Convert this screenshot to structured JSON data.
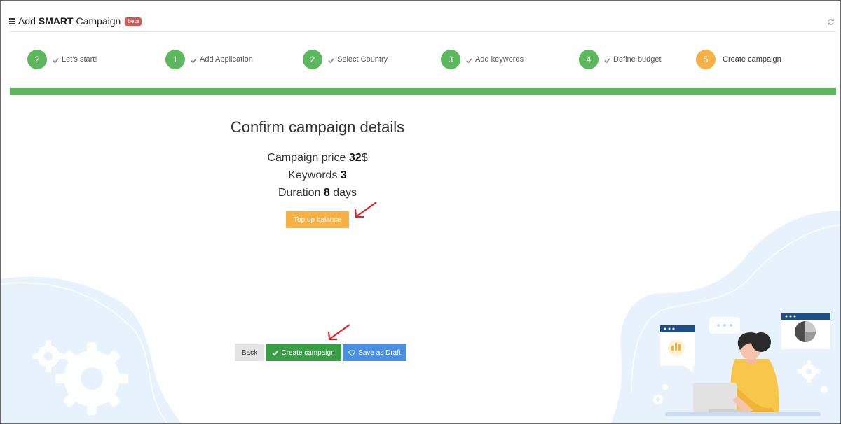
{
  "header": {
    "title_prefix": "Add ",
    "title_bold": "SMART",
    "title_suffix": " Campaign",
    "badge": "beta"
  },
  "steps": [
    {
      "marker": "?",
      "label": "Let's start!",
      "done": true
    },
    {
      "marker": "1",
      "label": "Add Application",
      "done": true
    },
    {
      "marker": "2",
      "label": "Select Country",
      "done": true
    },
    {
      "marker": "3",
      "label": "Add keywords",
      "done": true
    },
    {
      "marker": "4",
      "label": "Define budget",
      "done": true
    },
    {
      "marker": "5",
      "label": "Create campaign",
      "done": false,
      "active": true
    }
  ],
  "progress": 1.0,
  "confirm": {
    "title": "Confirm campaign details",
    "price_label": "Campaign price ",
    "price_value": "32",
    "price_unit": "$",
    "keywords_label": "Keywords ",
    "keywords_value": "3",
    "duration_label": "Duration ",
    "duration_value": "8",
    "duration_unit": " days"
  },
  "buttons": {
    "top_up": "Top up balance",
    "back": "Back",
    "create": "Create campaign",
    "draft": "Save as Draft"
  },
  "colors": {
    "green": "#5cb85c",
    "orange": "#f7b142",
    "dark_green": "#3a9e47",
    "blue": "#4a90e2",
    "badge_red": "#d9534f",
    "annotation_red": "#e0202a"
  }
}
